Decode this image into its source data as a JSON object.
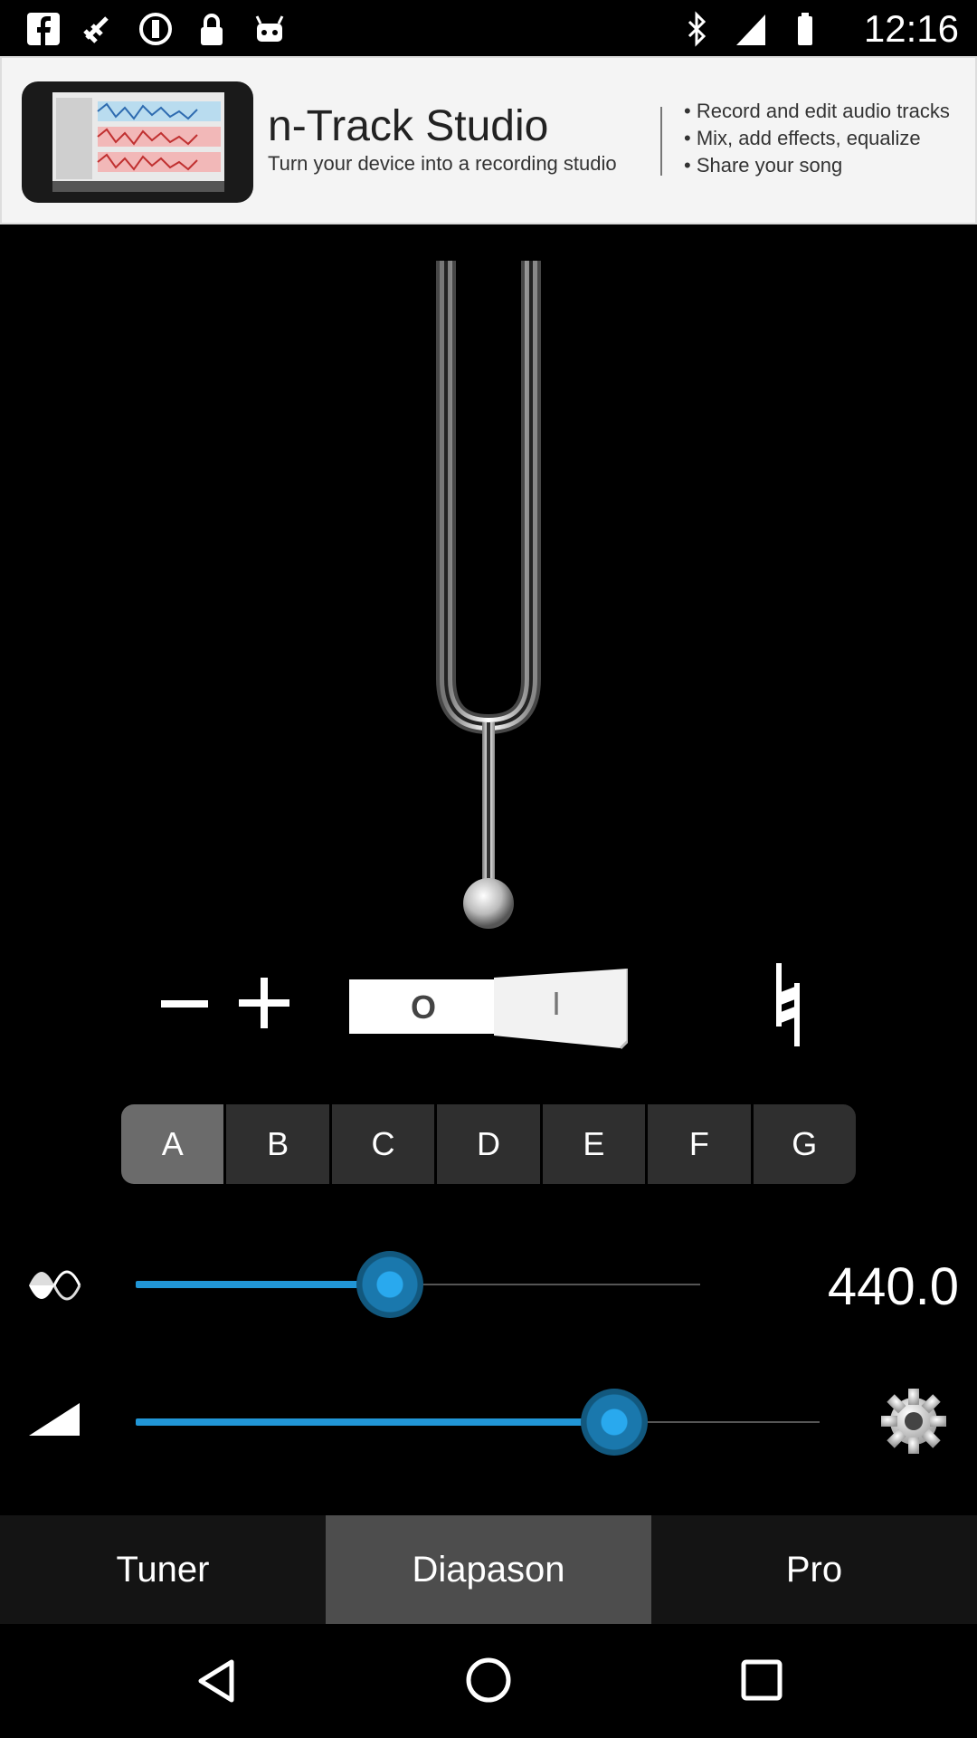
{
  "status_bar": {
    "time": "12:16",
    "left_icons": [
      "facebook-icon",
      "fake-gps-icon",
      "sync-icon",
      "lock-icon",
      "android-icon"
    ],
    "right_icons": [
      "bluetooth-icon",
      "signal-icon",
      "battery-icon"
    ]
  },
  "ad": {
    "title": "n-Track Studio",
    "subtitle": "Turn your device into a recording studio",
    "bullets": [
      "• Record and edit audio tracks",
      "• Mix, add effects, equalize",
      "• Share your song"
    ]
  },
  "controls": {
    "minus_label": "−",
    "plus_label": "+",
    "toggle_off": "O",
    "toggle_on": "I",
    "toggle_state": "on",
    "natural_symbol": "♮"
  },
  "notes": {
    "items": [
      "A",
      "B",
      "C",
      "D",
      "E",
      "F",
      "G"
    ],
    "selected": "A"
  },
  "frequency_slider": {
    "value_label": "440.0",
    "level": 0.45,
    "icon": "waveform-icon"
  },
  "volume_slider": {
    "level": 0.7,
    "icon": "volume-icon",
    "settings_icon": "gear-icon"
  },
  "tabs": [
    {
      "label": "Tuner",
      "active": false
    },
    {
      "label": "Diapason",
      "active": true
    },
    {
      "label": "Pro",
      "active": false
    }
  ],
  "colors": {
    "accent": "#2196d6",
    "tab_active": "#4d4d4d",
    "note_active": "#6b6b6b",
    "note_inactive": "#2f2f2f"
  }
}
